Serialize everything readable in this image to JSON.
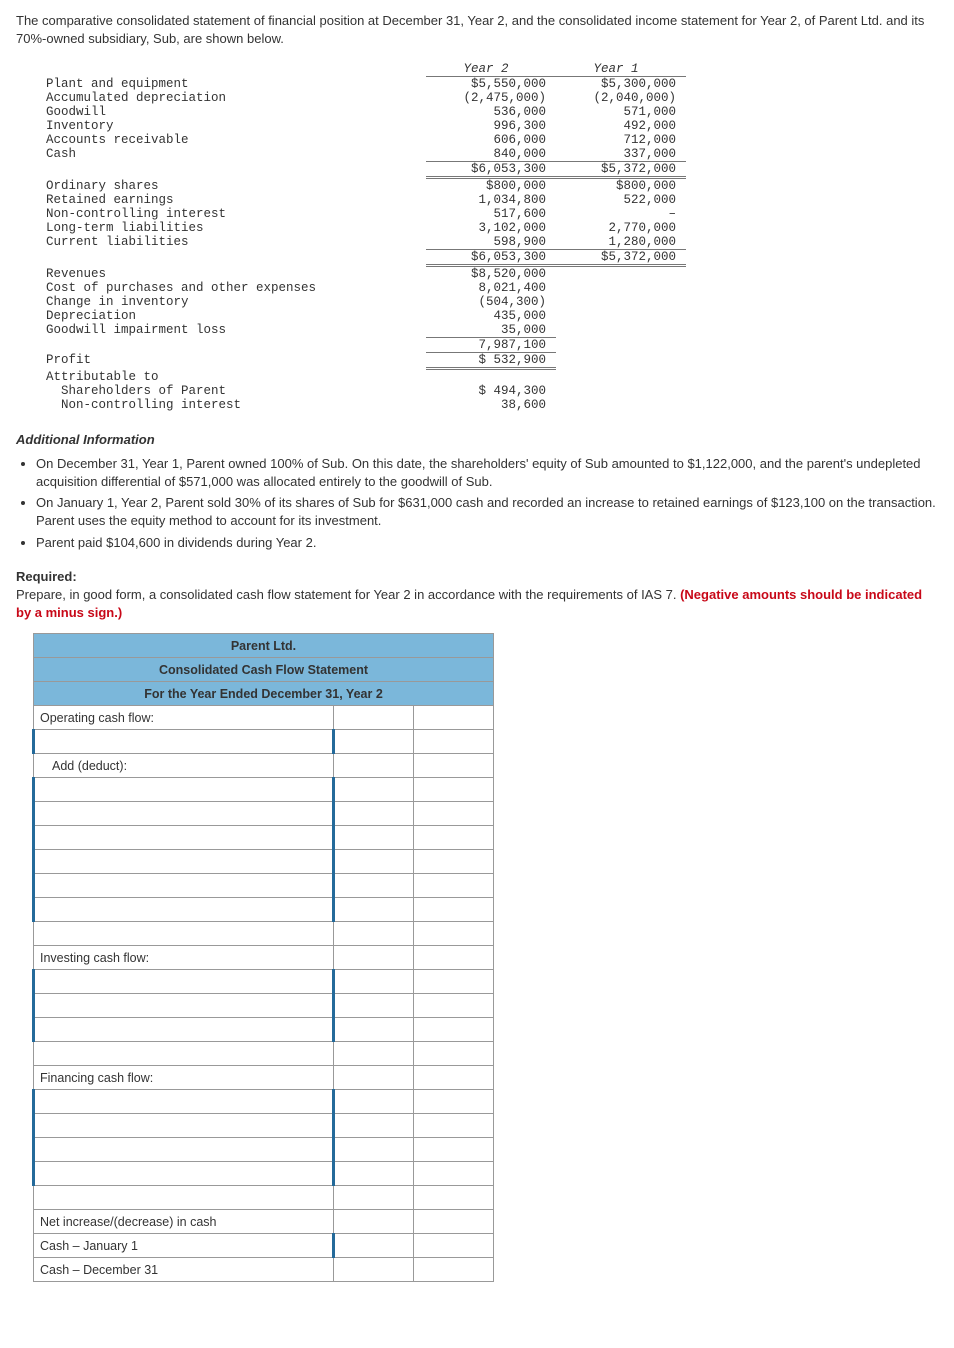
{
  "intro": "The comparative consolidated statement of financial position at December 31, Year 2, and the consolidated income statement for Year 2, of Parent Ltd. and its 70%-owned subsidiary, Sub, are shown below.",
  "headers": {
    "y2": "Year 2",
    "y1": "Year 1"
  },
  "block1": [
    {
      "label": "Plant and equipment",
      "y2": "$5,550,000",
      "y1": "$5,300,000"
    },
    {
      "label": "Accumulated depreciation",
      "y2": "(2,475,000)",
      "y1": "(2,040,000)"
    },
    {
      "label": "Goodwill",
      "y2": "536,000",
      "y1": "571,000"
    },
    {
      "label": "Inventory",
      "y2": "996,300",
      "y1": "492,000"
    },
    {
      "label": "Accounts receivable",
      "y2": "606,000",
      "y1": "712,000"
    },
    {
      "label": "Cash",
      "y2": "840,000",
      "y1": "337,000"
    }
  ],
  "block1_total": {
    "y2": "$6,053,300",
    "y1": "$5,372,000"
  },
  "block2": [
    {
      "label": "Ordinary shares",
      "y2": "$800,000",
      "y1": "$800,000"
    },
    {
      "label": "Retained earnings",
      "y2": "1,034,800",
      "y1": "522,000"
    },
    {
      "label": "Non-controlling interest",
      "y2": "517,600",
      "y1": "–"
    },
    {
      "label": "Long-term liabilities",
      "y2": "3,102,000",
      "y1": "2,770,000"
    },
    {
      "label": "Current liabilities",
      "y2": "598,900",
      "y1": "1,280,000"
    }
  ],
  "block2_total": {
    "y2": "$6,053,300",
    "y1": "$5,372,000"
  },
  "block3": [
    {
      "label": "Revenues",
      "y2": "$8,520,000"
    },
    {
      "label": "Cost of purchases and other expenses",
      "y2": "8,021,400"
    },
    {
      "label": "Change in inventory",
      "y2": "(504,300)"
    },
    {
      "label": "Depreciation",
      "y2": "435,000"
    },
    {
      "label": "Goodwill impairment loss",
      "y2": "35,000"
    }
  ],
  "block3_sub": {
    "y2": "7,987,100"
  },
  "profit_row": {
    "label": "Profit",
    "y2": "$ 532,900"
  },
  "attrib_head": "Attributable to",
  "attrib": [
    {
      "label": "  Shareholders of Parent",
      "y2": "$ 494,300"
    },
    {
      "label": "  Non-controlling interest",
      "y2": "38,600"
    }
  ],
  "additional_heading": "Additional Information",
  "additional": [
    "On December 31, Year 1, Parent owned 100% of Sub. On this date, the shareholders' equity of Sub amounted to $1,122,000, and the parent's undepleted acquisition differential of $571,000 was allocated entirely to the goodwill of Sub.",
    "On January 1, Year 2, Parent sold 30% of its shares of Sub for $631,000 cash and recorded an increase to retained earnings of $123,100 on the transaction. Parent uses the equity method to account for its investment.",
    "Parent paid $104,600 in dividends during Year 2."
  ],
  "required_label": "Required:",
  "required_text": "Prepare, in good form, a consolidated cash flow statement for Year 2 in accordance with the requirements of IAS 7. ",
  "required_warn": "(Negative amounts should be indicated by a minus sign.)",
  "form": {
    "h1": "Parent Ltd.",
    "h2": "Consolidated Cash Flow Statement",
    "h3": "For the Year Ended December 31, Year 2",
    "operating": "Operating cash flow:",
    "add_deduct": "Add (deduct):",
    "investing": "Investing cash flow:",
    "financing": "Financing cash flow:",
    "net": "Net increase/(decrease) in cash",
    "cash_jan": "Cash – January 1",
    "cash_dec": "Cash – December 31"
  }
}
